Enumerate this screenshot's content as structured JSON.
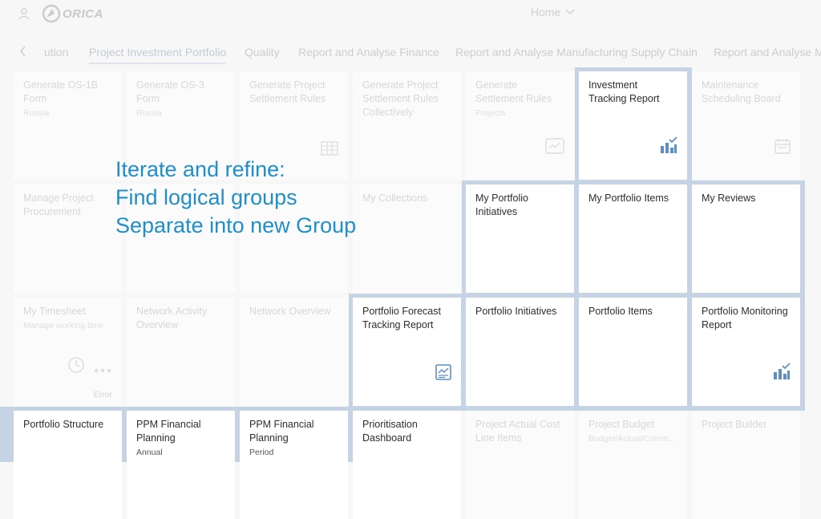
{
  "shell": {
    "logo_text": "ORICA",
    "home_label": "Home",
    "user_icon": "user-icon",
    "home_icon": "chevron-down-icon"
  },
  "tabs": [
    {
      "label": "ution"
    },
    {
      "label": "Project Investment Portfolio"
    },
    {
      "label": "Quality"
    },
    {
      "label": "Report and Analyse Finance"
    },
    {
      "label": "Report and Analyse Manufacturing Supply Chain"
    },
    {
      "label": "Report and Analyse M"
    }
  ],
  "overlay": {
    "lines": [
      "Iterate and refine:",
      "Find logical groups",
      "Separate into new Group"
    ]
  },
  "tiles": [
    {
      "title": "Generate OS-1B Form",
      "subtitle": "Russia",
      "footer": "",
      "icon": ""
    },
    {
      "title": "Generate OS-3 Form",
      "subtitle": "Russia",
      "footer": "",
      "icon": ""
    },
    {
      "title": "Generate Project Settlement Rules",
      "subtitle": "",
      "footer": "",
      "icon": "table-icon"
    },
    {
      "title": "Generate Project Settlement Rules Collectively",
      "subtitle": "",
      "footer": "",
      "icon": ""
    },
    {
      "title": "Generate Settlement Rules",
      "subtitle": "Projects",
      "footer": "",
      "icon": "report-icon"
    },
    {
      "title": "Investment Tracking Report",
      "subtitle": "",
      "footer": "",
      "icon": "analytics-icon"
    },
    {
      "title": "Maintenance Scheduling Board",
      "subtitle": "",
      "footer": "",
      "icon": "calendar-icon"
    },
    {
      "title": "Manage Project Procurement",
      "subtitle": "",
      "footer": "",
      "icon": ""
    },
    {
      "title": "My Collections",
      "subtitle": "",
      "footer": "",
      "icon": ""
    },
    {
      "title": "My Portfolio Initiatives",
      "subtitle": "",
      "footer": "",
      "icon": ""
    },
    {
      "title": "My Portfolio Items",
      "subtitle": "",
      "footer": "",
      "icon": ""
    },
    {
      "title": "My Reviews",
      "subtitle": "",
      "footer": "",
      "icon": ""
    },
    {
      "title": "My Timesheet",
      "subtitle": "Manage working time",
      "footer": "Error",
      "icon": "history-icon"
    },
    {
      "title": "Network Activity Overview",
      "subtitle": "",
      "footer": "",
      "icon": ""
    },
    {
      "title": "Network Overview",
      "subtitle": "",
      "footer": "",
      "icon": ""
    },
    {
      "title": "Portfolio Forecast Tracking Report",
      "subtitle": "",
      "footer": "",
      "icon": "forecast-icon"
    },
    {
      "title": "Portfolio Initiatives",
      "subtitle": "",
      "footer": "",
      "icon": ""
    },
    {
      "title": "Portfolio Items",
      "subtitle": "",
      "footer": "",
      "icon": ""
    },
    {
      "title": "Portfolio Monitoring Report",
      "subtitle": "",
      "footer": "",
      "icon": "analytics-icon"
    },
    {
      "title": "Portfolio Structure",
      "subtitle": "",
      "footer": "",
      "icon": ""
    },
    {
      "title": "PPM Financial Planning",
      "subtitle": "Annual",
      "footer": "",
      "icon": ""
    },
    {
      "title": "PPM Financial Planning",
      "subtitle": "Period",
      "footer": "",
      "icon": ""
    },
    {
      "title": "Prioritisation Dashboard",
      "subtitle": "",
      "footer": "",
      "icon": ""
    },
    {
      "title": "Project Actual Cost Line Items",
      "subtitle": "",
      "footer": "",
      "icon": ""
    },
    {
      "title": "Project Budget",
      "subtitle": "Budget/Actual/Comm...",
      "footer": "",
      "icon": ""
    },
    {
      "title": "Project Builder",
      "subtitle": "",
      "footer": "",
      "icon": ""
    }
  ]
}
